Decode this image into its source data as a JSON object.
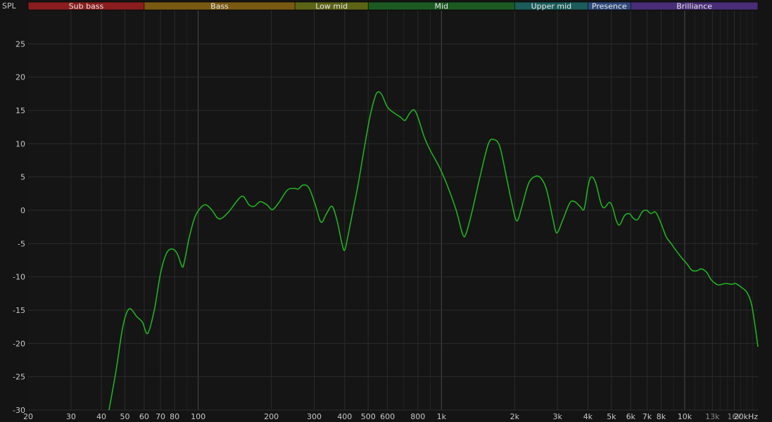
{
  "chart_data": {
    "type": "line",
    "ylabel": "SPL",
    "x_unit": "kHz",
    "x_scale": "log",
    "xlim": [
      20,
      20000
    ],
    "ylim": [
      -30,
      30
    ],
    "y_ticks": [
      -30,
      -25,
      -20,
      -15,
      -10,
      -5,
      0,
      5,
      10,
      15,
      20,
      25
    ],
    "x_ticks": [
      {
        "value": 20,
        "label": "20",
        "major": false,
        "dim": false
      },
      {
        "value": 30,
        "label": "30",
        "major": false,
        "dim": false
      },
      {
        "value": 40,
        "label": "40",
        "major": false,
        "dim": false
      },
      {
        "value": 50,
        "label": "50",
        "major": false,
        "dim": false
      },
      {
        "value": 60,
        "label": "60",
        "major": false,
        "dim": false
      },
      {
        "value": 70,
        "label": "70",
        "major": false,
        "dim": false
      },
      {
        "value": 80,
        "label": "80",
        "major": false,
        "dim": false
      },
      {
        "value": 100,
        "label": "100",
        "major": true,
        "dim": false
      },
      {
        "value": 200,
        "label": "200",
        "major": false,
        "dim": false
      },
      {
        "value": 300,
        "label": "300",
        "major": false,
        "dim": false
      },
      {
        "value": 400,
        "label": "400",
        "major": false,
        "dim": false
      },
      {
        "value": 500,
        "label": "500",
        "major": false,
        "dim": false
      },
      {
        "value": 600,
        "label": "600",
        "major": false,
        "dim": false
      },
      {
        "value": 800,
        "label": "800",
        "major": false,
        "dim": false
      },
      {
        "value": 1000,
        "label": "1k",
        "major": true,
        "dim": false
      },
      {
        "value": 2000,
        "label": "2k",
        "major": false,
        "dim": false
      },
      {
        "value": 3000,
        "label": "3k",
        "major": false,
        "dim": false
      },
      {
        "value": 4000,
        "label": "4k",
        "major": false,
        "dim": false
      },
      {
        "value": 5000,
        "label": "5k",
        "major": false,
        "dim": false
      },
      {
        "value": 6000,
        "label": "6k",
        "major": false,
        "dim": false
      },
      {
        "value": 7000,
        "label": "7k",
        "major": false,
        "dim": false
      },
      {
        "value": 8000,
        "label": "8k",
        "major": false,
        "dim": false
      },
      {
        "value": 10000,
        "label": "10k",
        "major": true,
        "dim": false
      },
      {
        "value": 13000,
        "label": "13k",
        "major": false,
        "dim": true
      },
      {
        "value": 16000,
        "label": "16k",
        "major": false,
        "dim": true
      },
      {
        "value": 20000,
        "label": "20kHz",
        "major": false,
        "dim": false
      }
    ],
    "minor_grid": [
      90,
      700,
      900,
      9000,
      11000,
      12000,
      14000,
      15000,
      17000,
      18000,
      19000
    ],
    "grid": true,
    "bands": [
      {
        "name": "Sub bass",
        "from": 20,
        "to": 60,
        "color": "#8a1e1e"
      },
      {
        "name": "Bass",
        "from": 60,
        "to": 250,
        "color": "#7a5a12"
      },
      {
        "name": "Low mid",
        "from": 250,
        "to": 500,
        "color": "#5c6416"
      },
      {
        "name": "Mid",
        "from": 500,
        "to": 2000,
        "color": "#1d5a22"
      },
      {
        "name": "Upper mid",
        "from": 2000,
        "to": 4000,
        "color": "#1c5c5a"
      },
      {
        "name": "Presence",
        "from": 4000,
        "to": 6000,
        "color": "#304a7c"
      },
      {
        "name": "Brilliance",
        "from": 6000,
        "to": 20000,
        "color": "#4a2d78"
      }
    ],
    "series": [
      {
        "color": "#22b022",
        "points": [
          [
            43,
            -30
          ],
          [
            46,
            -24
          ],
          [
            49,
            -17.5
          ],
          [
            52,
            -14.8
          ],
          [
            56,
            -16
          ],
          [
            59,
            -16.8
          ],
          [
            62,
            -18.5
          ],
          [
            66,
            -15
          ],
          [
            70,
            -9.5
          ],
          [
            74,
            -6.5
          ],
          [
            78,
            -5.8
          ],
          [
            82,
            -6.5
          ],
          [
            86,
            -8.5
          ],
          [
            88,
            -7.5
          ],
          [
            92,
            -4
          ],
          [
            97,
            -1
          ],
          [
            103,
            0.5
          ],
          [
            108,
            0.8
          ],
          [
            114,
            0
          ],
          [
            122,
            -1.3
          ],
          [
            133,
            -0.3
          ],
          [
            145,
            1.5
          ],
          [
            153,
            2.1
          ],
          [
            162,
            0.8
          ],
          [
            170,
            0.6
          ],
          [
            180,
            1.3
          ],
          [
            192,
            0.8
          ],
          [
            202,
            0.1
          ],
          [
            215,
            1.2
          ],
          [
            232,
            3
          ],
          [
            247,
            3.3
          ],
          [
            258,
            3.2
          ],
          [
            270,
            3.8
          ],
          [
            286,
            3.3
          ],
          [
            305,
            0.5
          ],
          [
            320,
            -1.8
          ],
          [
            337,
            -0.5
          ],
          [
            355,
            0.6
          ],
          [
            372,
            -1.5
          ],
          [
            390,
            -5
          ],
          [
            400,
            -6
          ],
          [
            412,
            -4
          ],
          [
            433,
            0
          ],
          [
            455,
            4
          ],
          [
            480,
            9
          ],
          [
            508,
            14
          ],
          [
            533,
            17
          ],
          [
            550,
            17.8
          ],
          [
            570,
            17.3
          ],
          [
            600,
            15.5
          ],
          [
            640,
            14.6
          ],
          [
            678,
            14
          ],
          [
            708,
            13.5
          ],
          [
            738,
            14.5
          ],
          [
            770,
            15.1
          ],
          [
            800,
            14
          ],
          [
            850,
            11
          ],
          [
            900,
            9
          ],
          [
            980,
            6.5
          ],
          [
            1050,
            4
          ],
          [
            1150,
            0
          ],
          [
            1220,
            -3.5
          ],
          [
            1260,
            -3.6
          ],
          [
            1340,
            0
          ],
          [
            1440,
            5
          ],
          [
            1560,
            10
          ],
          [
            1650,
            10.6
          ],
          [
            1740,
            9.5
          ],
          [
            1850,
            5
          ],
          [
            1950,
            1
          ],
          [
            2040,
            -1.6
          ],
          [
            2140,
            0.5
          ],
          [
            2280,
            4
          ],
          [
            2430,
            5.1
          ],
          [
            2570,
            4.8
          ],
          [
            2710,
            3
          ],
          [
            2880,
            -1.5
          ],
          [
            2980,
            -3.4
          ],
          [
            3150,
            -1.5
          ],
          [
            3370,
            1.1
          ],
          [
            3530,
            1.3
          ],
          [
            3710,
            0.6
          ],
          [
            3860,
            0.2
          ],
          [
            4000,
            3.5
          ],
          [
            4120,
            5
          ],
          [
            4300,
            4.2
          ],
          [
            4530,
            1
          ],
          [
            4680,
            0.4
          ],
          [
            4900,
            1.2
          ],
          [
            5050,
            0.5
          ],
          [
            5230,
            -1.5
          ],
          [
            5400,
            -2.2
          ],
          [
            5660,
            -0.8
          ],
          [
            5920,
            -0.5
          ],
          [
            6150,
            -1.2
          ],
          [
            6400,
            -1.4
          ],
          [
            6700,
            -0.2
          ],
          [
            6980,
            0
          ],
          [
            7250,
            -0.5
          ],
          [
            7600,
            -0.3
          ],
          [
            8000,
            -2
          ],
          [
            8400,
            -4
          ],
          [
            8800,
            -5
          ],
          [
            9200,
            -6
          ],
          [
            9800,
            -7.3
          ],
          [
            10200,
            -8
          ],
          [
            10700,
            -9
          ],
          [
            11200,
            -9.1
          ],
          [
            11700,
            -8.8
          ],
          [
            12300,
            -9.3
          ],
          [
            12900,
            -10.5
          ],
          [
            13700,
            -11.2
          ],
          [
            14700,
            -11
          ],
          [
            15600,
            -11.1
          ],
          [
            16200,
            -11
          ],
          [
            17000,
            -11.5
          ],
          [
            18000,
            -12.3
          ],
          [
            18800,
            -14
          ],
          [
            19400,
            -17
          ],
          [
            20000,
            -20.5
          ]
        ]
      }
    ]
  }
}
